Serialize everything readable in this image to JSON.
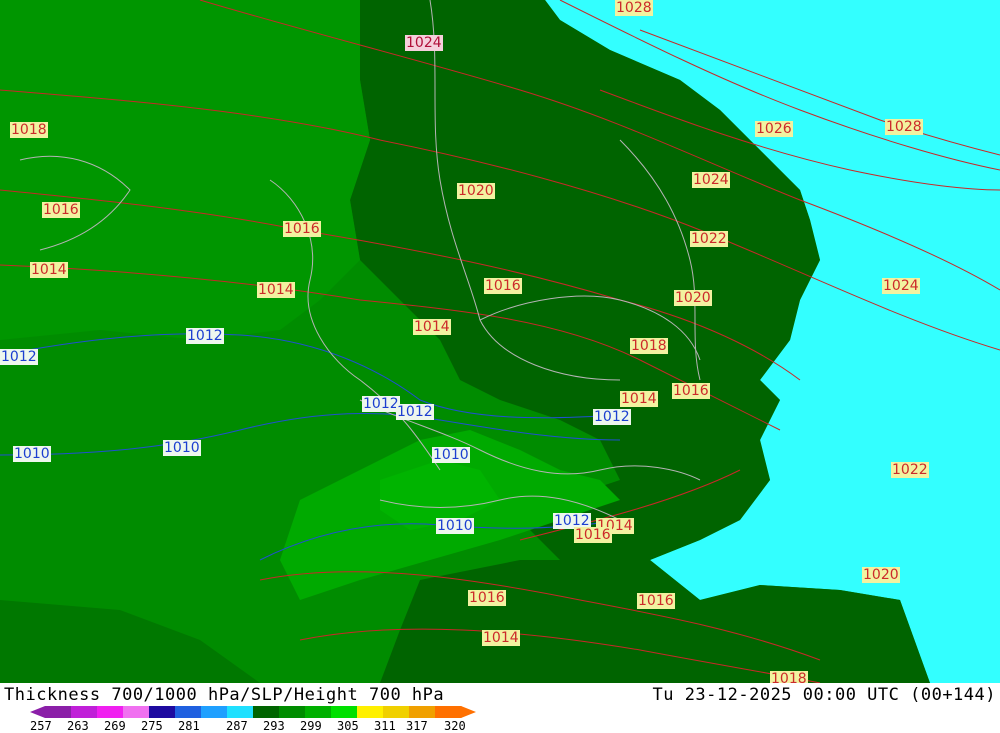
{
  "title_left": "Thickness 700/1000 hPa/SLP/Height 700 hPa",
  "title_right": "Tu 23-12-2025 00:00 UTC (00+144)",
  "colors": {
    "sea": "#33ffff",
    "green_dark": "#006400",
    "green_mid": "#008c00",
    "green_light": "#00aa00",
    "isobar": "#c82828",
    "isobar_low": "#2050d0",
    "border": "#b4b4b4"
  },
  "color_scale": {
    "tick_labels": [
      "257",
      "263",
      "269",
      "275",
      "281",
      "287",
      "293",
      "299",
      "305",
      "311",
      "317",
      "320"
    ],
    "colors": [
      "#8b1fa8",
      "#c020d8",
      "#f020f0",
      "#f070f0",
      "#1e0aa0",
      "#2060e0",
      "#20a0ff",
      "#20e0ff",
      "#006400",
      "#008c00",
      "#00b000",
      "#00e000",
      "#fff000",
      "#f0d000",
      "#f0a000",
      "#ff7000"
    ]
  },
  "isobar_labels": [
    {
      "text": "1028",
      "style": "red"
    },
    {
      "text": "1024",
      "style": "pink"
    },
    {
      "text": "1018",
      "style": "red"
    },
    {
      "text": "1026",
      "style": "red"
    },
    {
      "text": "1028",
      "style": "red"
    },
    {
      "text": "1020",
      "style": "red"
    },
    {
      "text": "1024",
      "style": "red"
    },
    {
      "text": "1016",
      "style": "red"
    },
    {
      "text": "1016",
      "style": "red"
    },
    {
      "text": "1022",
      "style": "red"
    },
    {
      "text": "1014",
      "style": "red"
    },
    {
      "text": "1014",
      "style": "red"
    },
    {
      "text": "1016",
      "style": "red"
    },
    {
      "text": "1020",
      "style": "red"
    },
    {
      "text": "1024",
      "style": "red"
    },
    {
      "text": "1014",
      "style": "red"
    },
    {
      "text": "1012",
      "style": "blue"
    },
    {
      "text": "1018",
      "style": "red"
    },
    {
      "text": "1012",
      "style": "blue"
    },
    {
      "text": "1016",
      "style": "red"
    },
    {
      "text": "1014",
      "style": "red"
    },
    {
      "text": "1012",
      "style": "blue"
    },
    {
      "text": "1012",
      "style": "blue"
    },
    {
      "text": "1012",
      "style": "blue"
    },
    {
      "text": "1010",
      "style": "blue"
    },
    {
      "text": "1010",
      "style": "blue"
    },
    {
      "text": "1010",
      "style": "blue"
    },
    {
      "text": "1022",
      "style": "red"
    },
    {
      "text": "1010",
      "style": "blue"
    },
    {
      "text": "1012",
      "style": "blue"
    },
    {
      "text": "1014",
      "style": "red"
    },
    {
      "text": "1016",
      "style": "red"
    },
    {
      "text": "1020",
      "style": "red"
    },
    {
      "text": "1016",
      "style": "red"
    },
    {
      "text": "1016",
      "style": "red"
    },
    {
      "text": "1014",
      "style": "red"
    },
    {
      "text": "1018",
      "style": "red"
    }
  ]
}
